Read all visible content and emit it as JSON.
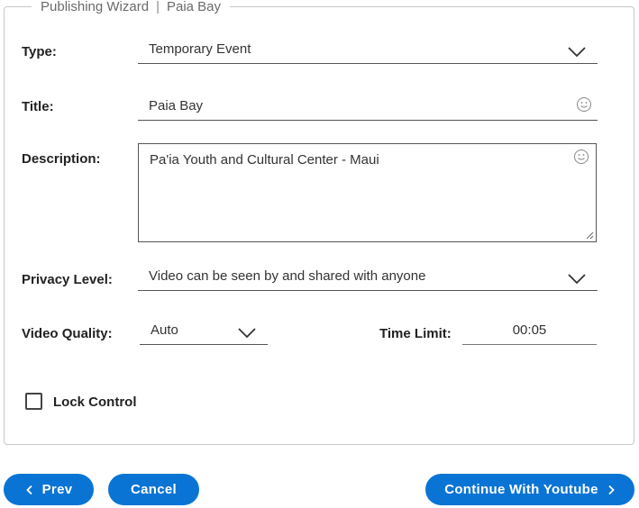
{
  "wizard": {
    "legend_title": "Publishing Wizard",
    "legend_separator": "|",
    "legend_subtitle": "Paia Bay"
  },
  "form": {
    "type_label": "Type:",
    "type_value": "Temporary Event",
    "title_label": "Title:",
    "title_value": "Paia Bay",
    "description_label": "Description:",
    "description_value": "Pa'ia Youth and Cultural Center - Maui",
    "privacy_label": "Privacy Level:",
    "privacy_value": "Video can be seen by and shared with anyone",
    "quality_label": "Video Quality:",
    "quality_value": "Auto",
    "time_limit_label": "Time Limit:",
    "time_limit_value": "00:05",
    "lock_control_label": "Lock Control",
    "lock_control_checked": false
  },
  "buttons": {
    "prev_label": "Prev",
    "cancel_label": "Cancel",
    "continue_label": "Continue With Youtube"
  },
  "icons": {
    "dropdown": "chevron-down-icon",
    "emoji": "smiley-icon",
    "prev": "chevron-left-icon",
    "next": "chevron-right-icon"
  },
  "colors": {
    "accent": "#0a74d4",
    "border": "#c7c7c7"
  }
}
